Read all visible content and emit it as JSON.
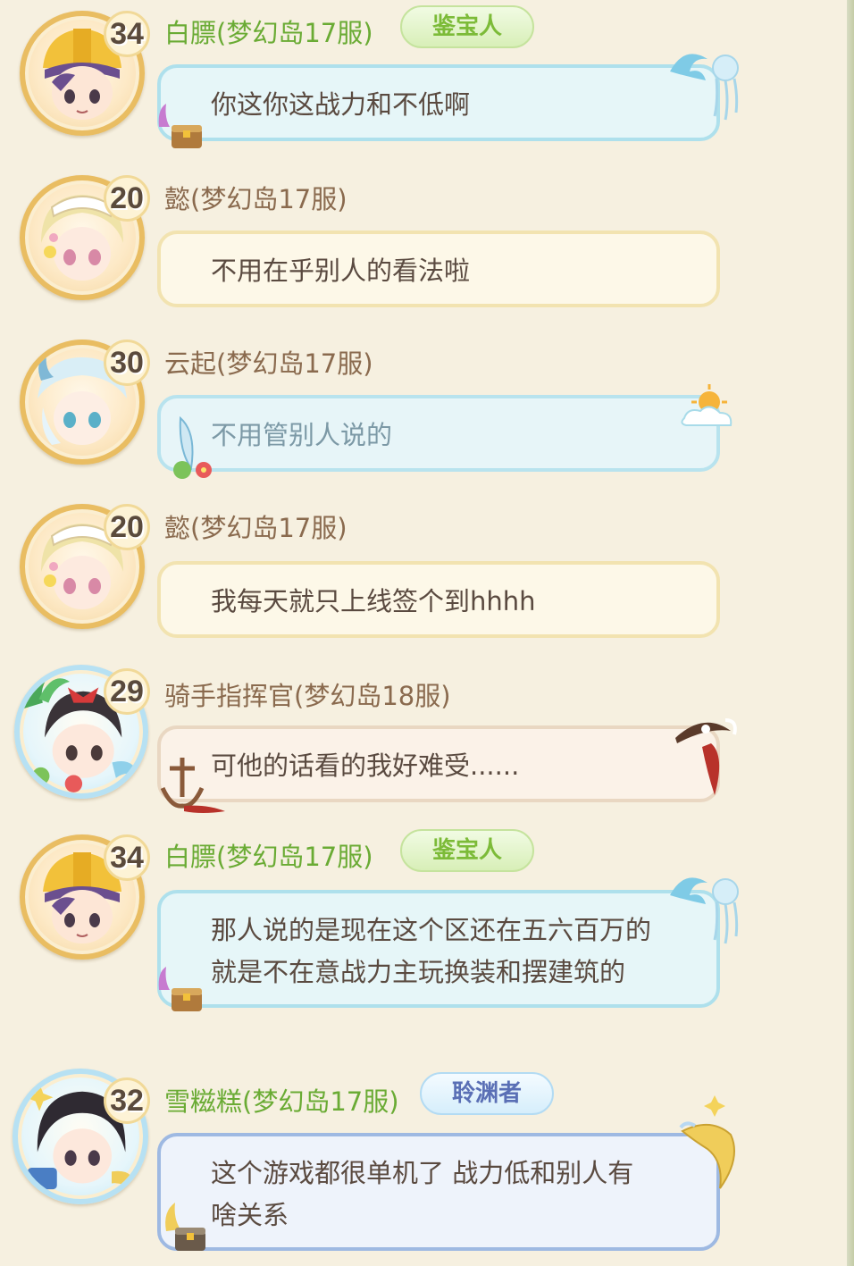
{
  "messages": [
    {
      "level": "34",
      "name": "白膘(梦幻岛17服)",
      "badge": "鉴宝人",
      "lines": [
        "你这你这战力和不低啊"
      ]
    },
    {
      "level": "20",
      "name": "懿(梦幻岛17服)",
      "lines": [
        "不用在乎别人的看法啦"
      ]
    },
    {
      "level": "30",
      "name": "云起(梦幻岛17服)",
      "lines": [
        "不用管别人说的"
      ]
    },
    {
      "level": "20",
      "name": "懿(梦幻岛17服)",
      "lines": [
        "我每天就只上线签个到hhhh"
      ]
    },
    {
      "level": "29",
      "name": "骑手指挥官(梦幻岛18服)",
      "lines": [
        "可他的话看的我好难受......"
      ]
    },
    {
      "level": "34",
      "name": "白膘(梦幻岛17服)",
      "badge": "鉴宝人",
      "lines": [
        "那人说的是现在这个区还在五六百万的",
        "就是不在意战力主玩换装和摆建筑的"
      ]
    },
    {
      "level": "32",
      "name": "雪糍糕(梦幻岛17服)",
      "badge": "聆渊者",
      "lines": [
        "这个游戏都很单机了 战力低和别人有",
        "啥关系"
      ]
    }
  ],
  "colors": {
    "name_green": "#6aab34",
    "name_brown": "#8a6a4e",
    "background": "#f6f0e0"
  }
}
